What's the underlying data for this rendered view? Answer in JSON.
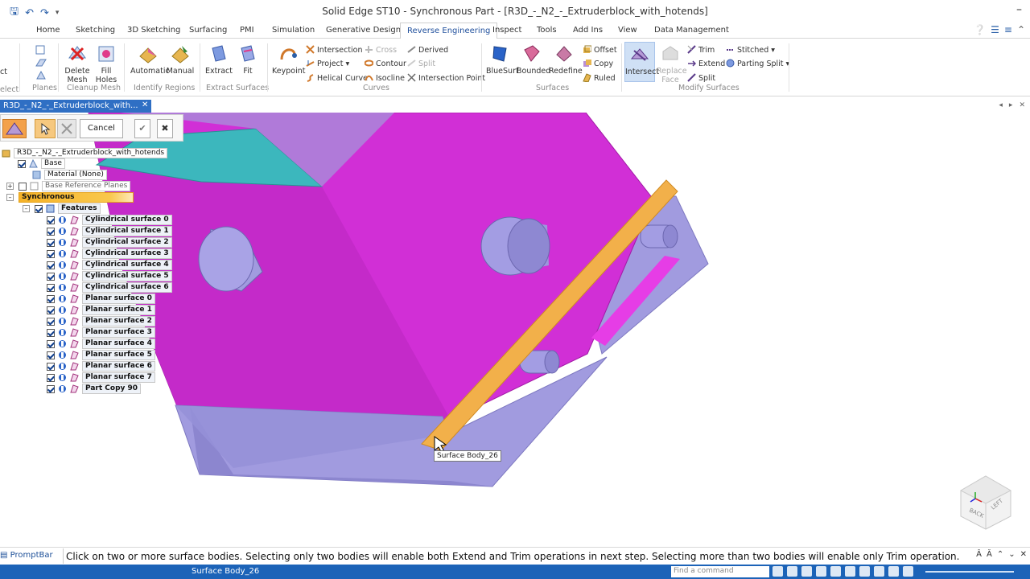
{
  "app": {
    "title": "Solid Edge ST10 - Synchronous Part - [R3D_-_N2_-_Extruderblock_with_hotends]"
  },
  "ribbon_tabs": [
    "Home",
    "Sketching",
    "3D Sketching",
    "Surfacing",
    "PMI",
    "Simulation",
    "Generative Design",
    "Reverse Engineering",
    "Inspect",
    "Tools",
    "Add Ins",
    "View",
    "Data Management"
  ],
  "active_tab": "Reverse Engineering",
  "ribbon": {
    "partial_left": {
      "select_label": "elect",
      "select_top": "ct",
      "planes": "Planes"
    },
    "cleanup": {
      "delete_mesh": "Delete Mesh",
      "fill_holes": "Fill Holes",
      "group": "Cleanup Mesh"
    },
    "identify": {
      "automatic": "Automatic",
      "manual": "Manual",
      "group": "Identify Regions"
    },
    "extract": {
      "extract": "Extract",
      "fit": "Fit",
      "group": "Extract Surfaces"
    },
    "curves": {
      "keypoint": "Keypoint",
      "intersection": "Intersection",
      "project": "Project",
      "helical_curve": "Helical Curve",
      "cross": "Cross",
      "contour": "Contour",
      "isocline": "Isocline",
      "derived": "Derived",
      "split": "Split",
      "intersection_point": "Intersection Point",
      "group": "Curves"
    },
    "surfaces": {
      "bluesurf": "BlueSurf",
      "bounded": "Bounded",
      "redefine": "Redefine",
      "offset": "Offset",
      "copy": "Copy",
      "ruled": "Ruled",
      "group": "Surfaces"
    },
    "modify": {
      "intersect": "Intersect",
      "replace_face": "Replace Face",
      "trim": "Trim",
      "extend": "Extend",
      "split": "Split",
      "stitched": "Stitched",
      "parting_split": "Parting Split",
      "group": "Modify Surfaces"
    }
  },
  "document_tab": {
    "label": "R3D_-_N2_-_Extruderblock_with...",
    "close": "✕"
  },
  "command_bar": {
    "cancel": "Cancel"
  },
  "tree": {
    "root": "R3D_-_N2_-_Extruderblock_with_hotends",
    "base": "Base",
    "material": "Material (None)",
    "base_ref_planes": "Base Reference Planes",
    "synchronous": "Synchronous",
    "features": "Features",
    "items": [
      "Cylindrical surface 0",
      "Cylindrical surface 1",
      "Cylindrical surface 2",
      "Cylindrical surface 3",
      "Cylindrical surface 4",
      "Cylindrical surface 5",
      "Cylindrical surface 6",
      "Planar surface 0",
      "Planar surface 1",
      "Planar surface 2",
      "Planar surface 3",
      "Planar surface 4",
      "Planar surface 5",
      "Planar surface 6",
      "Planar surface 7",
      "Part Copy 90"
    ]
  },
  "viewport": {
    "tooltip": "Surface Body_26",
    "viewcube": {
      "back": "BACK",
      "left": "LEFT"
    }
  },
  "promptbar": {
    "label": "PromptBar",
    "message": "Click on two or more surface bodies. Selecting only two bodies will enable both Extend and Trim operations in next step. Selecting more than two bodies will enable only Trim operation."
  },
  "statusbar": {
    "text": "Surface Body_26",
    "find_placeholder": "Find a command"
  },
  "colors": {
    "magenta_body": "#d52fd5",
    "lavender_surface": "#9b99dd",
    "teal_face": "#3ab3b8",
    "orange_selected": "#f2b04a",
    "accent_blue": "#1c63b8"
  }
}
